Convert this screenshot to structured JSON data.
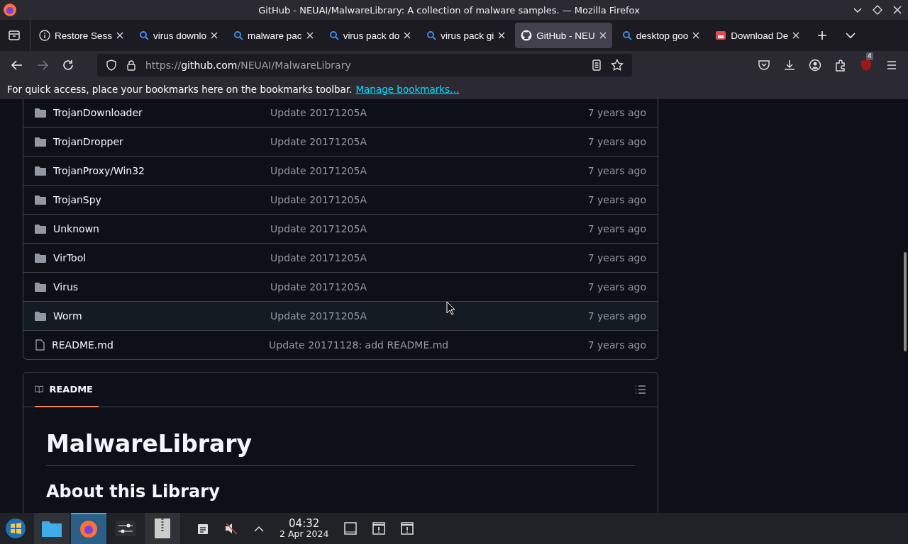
{
  "window": {
    "title": "GitHub - NEUAI/MalwareLibrary: A collection of malware samples. — Mozilla Firefox"
  },
  "tabs": [
    {
      "label": "Restore Sess",
      "kind": "info",
      "selected": false
    },
    {
      "label": "virus downlo",
      "kind": "search",
      "selected": false
    },
    {
      "label": "malware pac",
      "kind": "search",
      "selected": false
    },
    {
      "label": "virus pack do",
      "kind": "search",
      "selected": false
    },
    {
      "label": "virus pack gi",
      "kind": "search",
      "selected": false
    },
    {
      "label": "GitHub - NEU",
      "kind": "github",
      "selected": true
    },
    {
      "label": "desktop goo",
      "kind": "search",
      "selected": false
    },
    {
      "label": "Download De",
      "kind": "store",
      "selected": false
    }
  ],
  "address": {
    "host_prefix": "https://",
    "host": "github.com",
    "path": "/NEUAI/MalwareLibrary"
  },
  "extension_badge": "4",
  "bookmarks_bar": {
    "message": "For quick access, place your bookmarks here on the bookmarks toolbar.",
    "link": "Manage bookmarks…"
  },
  "files": [
    {
      "name": "TrojanDownloader",
      "kind": "folder",
      "commit": "Update 20171205A",
      "time": "7 years ago",
      "hovered": false
    },
    {
      "name": "TrojanDropper",
      "kind": "folder",
      "commit": "Update 20171205A",
      "time": "7 years ago",
      "hovered": false
    },
    {
      "name": "TrojanProxy/Win32",
      "kind": "folder",
      "commit": "Update 20171205A",
      "time": "7 years ago",
      "hovered": false
    },
    {
      "name": "TrojanSpy",
      "kind": "folder",
      "commit": "Update 20171205A",
      "time": "7 years ago",
      "hovered": false
    },
    {
      "name": "Unknown",
      "kind": "folder",
      "commit": "Update 20171205A",
      "time": "7 years ago",
      "hovered": false
    },
    {
      "name": "VirTool",
      "kind": "folder",
      "commit": "Update 20171205A",
      "time": "7 years ago",
      "hovered": false
    },
    {
      "name": "Virus",
      "kind": "folder",
      "commit": "Update 20171205A",
      "time": "7 years ago",
      "hovered": false
    },
    {
      "name": "Worm",
      "kind": "folder",
      "commit": "Update 20171205A",
      "time": "7 years ago",
      "hovered": true
    },
    {
      "name": "README.md",
      "kind": "file",
      "commit": "Update 20171128: add README.md",
      "time": "7 years ago",
      "hovered": false
    }
  ],
  "readme": {
    "tab": "README",
    "title": "MalwareLibrary",
    "subtitle": "About this Library"
  },
  "taskbar": {
    "time": "04:32",
    "date": "2 Apr 2024"
  }
}
